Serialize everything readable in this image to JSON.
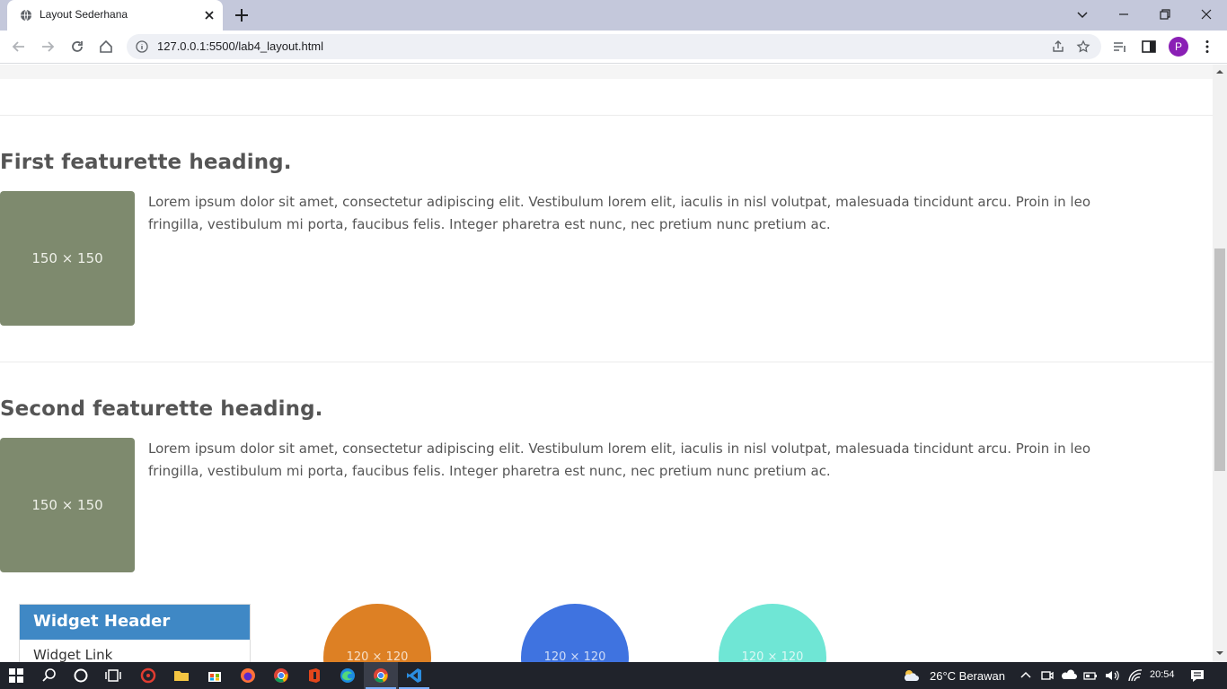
{
  "browser": {
    "tab_title": "Layout Sederhana",
    "url": "127.0.0.1:5500/lab4_layout.html",
    "profile_initial": "P"
  },
  "page": {
    "features": [
      {
        "heading": "First featurette heading.",
        "image_label": "150 × 150",
        "text": "Lorem ipsum dolor sit amet, consectetur adipiscing elit. Vestibulum lorem elit, iaculis in nisl volutpat, malesuada tincidunt arcu. Proin in leo fringilla, vestibulum mi porta, faucibus felis. Integer pharetra est nunc, nec pretium nunc pretium ac."
      },
      {
        "heading": "Second featurette heading.",
        "image_label": "150 × 150",
        "text": "Lorem ipsum dolor sit amet, consectetur adipiscing elit. Vestibulum lorem elit, iaculis in nisl volutpat, malesuada tincidunt arcu. Proin in leo fringilla, vestibulum mi porta, faucibus felis. Integer pharetra est nunc, nec pretium nunc pretium ac."
      }
    ],
    "widget": {
      "header": "Widget Header",
      "link": "Widget Link"
    },
    "circles": [
      {
        "label": "120 × 120",
        "color": "#dd8024"
      },
      {
        "label": "120 × 120",
        "color": "#3f73e0"
      },
      {
        "label": "120 × 120",
        "color": "#6fe6d5"
      }
    ],
    "colors": {
      "image_placeholder": "#7e8a6e",
      "widget_header": "#3f88c5",
      "heading_text": "#555555"
    }
  },
  "taskbar": {
    "weather": "26°C  Berawan",
    "time": "20:54"
  }
}
